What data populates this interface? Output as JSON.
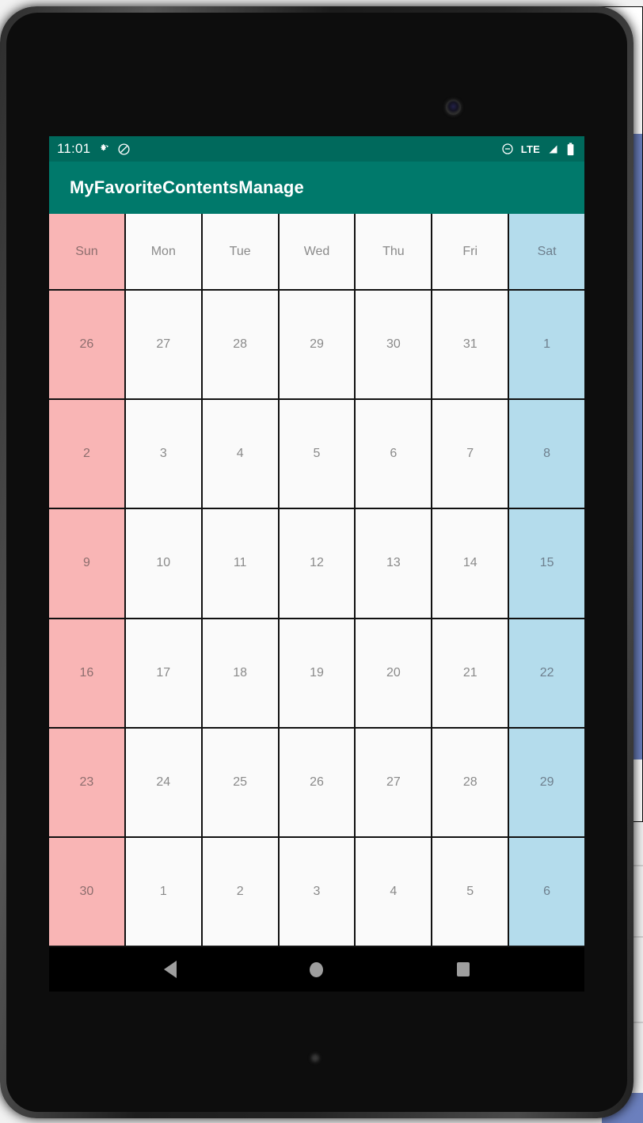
{
  "background": {
    "description": "partially visible desktop window behind tablet"
  },
  "device": {
    "camera_icon": "front-camera",
    "sensor_icon": "bottom-sensor"
  },
  "status_bar": {
    "time": "11:01",
    "left_icons": [
      "developer-options-icon",
      "do-not-disturb-icon"
    ],
    "right_icons": [
      "do-not-disturb-icon",
      "signal-icon",
      "battery-icon"
    ],
    "network_label": "LTE",
    "background_color": "#00695c"
  },
  "app_bar": {
    "title": "MyFavoriteContentsManage",
    "background_color": "#00796b",
    "text_color": "#ffffff"
  },
  "calendar": {
    "weekday_headers": [
      "Sun",
      "Mon",
      "Tue",
      "Wed",
      "Thu",
      "Fri",
      "Sat"
    ],
    "sunday_color": "#f9b5b5",
    "saturday_color": "#b4dcec",
    "weekday_color": "#fafafa",
    "grid_line_color": "#111111",
    "weeks": [
      [
        "26",
        "27",
        "28",
        "29",
        "30",
        "31",
        "1"
      ],
      [
        "2",
        "3",
        "4",
        "5",
        "6",
        "7",
        "8"
      ],
      [
        "9",
        "10",
        "11",
        "12",
        "13",
        "14",
        "15"
      ],
      [
        "16",
        "17",
        "18",
        "19",
        "20",
        "21",
        "22"
      ],
      [
        "23",
        "24",
        "25",
        "26",
        "27",
        "28",
        "29"
      ],
      [
        "30",
        "1",
        "2",
        "3",
        "4",
        "5",
        "6"
      ]
    ]
  },
  "nav_bar": {
    "buttons": [
      "back-button",
      "home-button",
      "recents-button"
    ],
    "background_color": "#000000",
    "icon_color": "#9e9e9e"
  }
}
